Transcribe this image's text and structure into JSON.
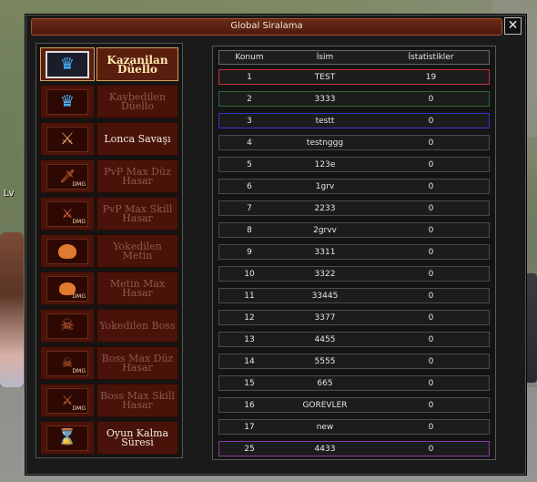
{
  "background": {
    "player_name_fragment": "Lv"
  },
  "window": {
    "title": "Global Siralama",
    "close_glyph": "✕"
  },
  "categories": [
    {
      "label": "Kazanilan Düello",
      "icon": "crown-icon",
      "active": true
    },
    {
      "label": "Kaybedilen Düello",
      "icon": "crown-icon",
      "active": false
    },
    {
      "label": "Lonca Savaşı",
      "icon": "crossed-swords-icon",
      "active": false,
      "strong": true
    },
    {
      "label": "PvP Max Düz Hasar",
      "icon": "sword-dmg-icon",
      "active": false
    },
    {
      "label": "PvP Max Skill Hasar",
      "icon": "sword-skill-dmg-icon",
      "active": false
    },
    {
      "label": "Yokedilen Metin",
      "icon": "stone-icon",
      "active": false
    },
    {
      "label": "Metin Max Hasar",
      "icon": "stone-dmg-icon",
      "active": false
    },
    {
      "label": "Yokedilen Boss",
      "icon": "boss-demon-icon",
      "active": false
    },
    {
      "label": "Boss Max Düz Hasar",
      "icon": "boss-dmg-icon",
      "active": false
    },
    {
      "label": "Boss Max Skill Hasar",
      "icon": "boss-skill-dmg-icon",
      "active": false
    },
    {
      "label": "Oyun Kalma Süresi",
      "icon": "hourglass-icon",
      "active": false,
      "strong": true
    }
  ],
  "ranking": {
    "headers": {
      "rank": "Konum",
      "name": "İsim",
      "stat": "İstatistikler"
    },
    "rows": [
      {
        "rank": "1",
        "name": "TEST",
        "stat": "19",
        "highlight": "#c0323c"
      },
      {
        "rank": "2",
        "name": "3333",
        "stat": "0",
        "highlight": "#2f6a34"
      },
      {
        "rank": "3",
        "name": "testt",
        "stat": "0",
        "highlight": "#3434c8"
      },
      {
        "rank": "4",
        "name": "testnggg",
        "stat": "0"
      },
      {
        "rank": "5",
        "name": "123e",
        "stat": "0"
      },
      {
        "rank": "6",
        "name": "1grv",
        "stat": "0"
      },
      {
        "rank": "7",
        "name": "2233",
        "stat": "0"
      },
      {
        "rank": "8",
        "name": "2grvv",
        "stat": "0"
      },
      {
        "rank": "9",
        "name": "3311",
        "stat": "0"
      },
      {
        "rank": "10",
        "name": "3322",
        "stat": "0"
      },
      {
        "rank": "11",
        "name": "33445",
        "stat": "0"
      },
      {
        "rank": "12",
        "name": "3377",
        "stat": "0"
      },
      {
        "rank": "13",
        "name": "4455",
        "stat": "0"
      },
      {
        "rank": "14",
        "name": "5555",
        "stat": "0"
      },
      {
        "rank": "15",
        "name": "665",
        "stat": "0"
      },
      {
        "rank": "16",
        "name": "GOREVLER",
        "stat": "0"
      },
      {
        "rank": "17",
        "name": "new",
        "stat": "0"
      },
      {
        "rank": "25",
        "name": "4433",
        "stat": "0",
        "highlight": "#8a3aa8"
      }
    ]
  },
  "colors": {
    "title_bar": "#6b2a17",
    "category_bg": "#4a1309",
    "active_border": "#d2a15a",
    "row_bg": "#1c1c1c"
  }
}
